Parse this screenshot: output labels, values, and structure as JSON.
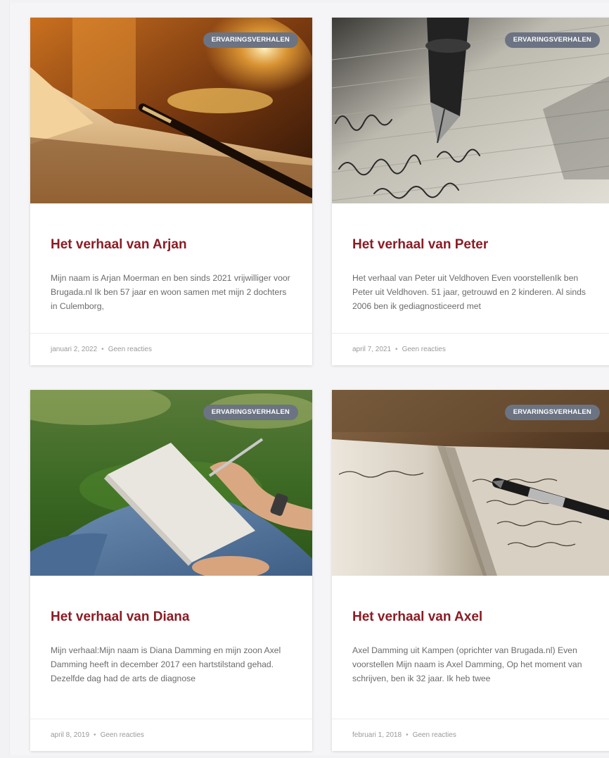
{
  "posts": [
    {
      "category": "ERVARINGSVERHALEN",
      "title": "Het verhaal van Arjan",
      "excerpt": "Mijn naam is Arjan Moerman en ben sinds 2021 vrijwilliger voor Brugada.nl Ik ben 57 jaar en woon samen met mijn 2 dochters in Culemborg,",
      "date": "januari 2, 2022",
      "separator": "•",
      "comments": "Geen reacties",
      "image_icon": "fountain-pen-lamp-photo"
    },
    {
      "category": "ERVARINGSVERHALEN",
      "title": "Het verhaal van Peter",
      "excerpt": "Het verhaal van Peter uit Veldhoven Even voorstellenIk ben Peter uit Veldhoven. 51 jaar, getrouwd en 2 kinderen. Al sinds 2006 ben ik gediagnosticeerd met",
      "date": "april 7, 2021",
      "separator": "•",
      "comments": "Geen reacties",
      "image_icon": "fountain-pen-writing-photo"
    },
    {
      "category": "ERVARINGSVERHALEN",
      "title": "Het verhaal van Diana",
      "excerpt": "Mijn verhaal:Mijn naam is Diana Damming en mijn zoon Axel Damming heeft in december 2017 een hartstilstand gehad. Dezelfde dag had de arts de diagnose",
      "date": "april 8, 2019",
      "separator": "•",
      "comments": "Geen reacties",
      "image_icon": "writing-in-grass-photo"
    },
    {
      "category": "ERVARINGSVERHALEN",
      "title": "Het verhaal van Axel",
      "excerpt": "Axel Damming uit Kampen (oprichter van Brugada.nl) Even voorstellen Mijn naam is Axel Damming, Op het moment van schrijven, ben ik 32 jaar. Ik heb twee",
      "date": "februari 1, 2018",
      "separator": "•",
      "comments": "Geen reacties",
      "image_icon": "open-notebook-pen-photo"
    }
  ],
  "colors": {
    "title": "#8b1c24",
    "badge": "#6c7383",
    "excerpt": "#6b6b6b",
    "meta": "#9a9a9a",
    "page_bg": "#f5f5f7"
  }
}
